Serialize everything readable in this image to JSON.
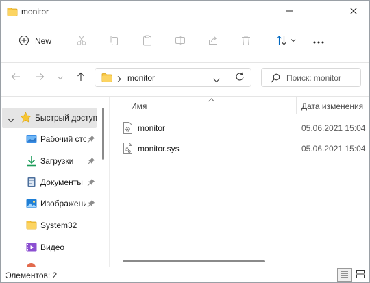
{
  "window": {
    "title": "monitor"
  },
  "toolbar": {
    "new_label": "New",
    "icons": [
      "plus-circle-icon",
      "cut-icon",
      "copy-icon",
      "paste-icon",
      "rename-icon",
      "share-icon",
      "delete-icon",
      "sort-icon",
      "more-icon"
    ]
  },
  "address": {
    "path": "monitor"
  },
  "search": {
    "placeholder": "Поиск: monitor"
  },
  "sidebar": {
    "items": [
      {
        "label": "Быстрый доступ",
        "icon": "star-icon",
        "pinned": false
      },
      {
        "label": "Рабочий стол",
        "icon": "desktop-icon",
        "pinned": true
      },
      {
        "label": "Загрузки",
        "icon": "download-icon",
        "pinned": true
      },
      {
        "label": "Документы",
        "icon": "documents-icon",
        "pinned": true
      },
      {
        "label": "Изображения",
        "icon": "pictures-icon",
        "pinned": true
      },
      {
        "label": "System32",
        "icon": "folder-icon",
        "pinned": false
      },
      {
        "label": "Видео",
        "icon": "video-icon",
        "pinned": false
      }
    ]
  },
  "filelist": {
    "columns": {
      "name": "Имя",
      "date": "Дата изменения"
    },
    "files": [
      {
        "name": "monitor",
        "date": "05.06.2021 15:04",
        "icon": "settings-file-icon"
      },
      {
        "name": "monitor.sys",
        "date": "05.06.2021 15:04",
        "icon": "system-file-icon"
      }
    ]
  },
  "status": {
    "items_count": "Элементов: 2"
  },
  "colors": {
    "accent": "#0067c0",
    "folder": "#f8c540",
    "selection": "#e5e5e5"
  }
}
